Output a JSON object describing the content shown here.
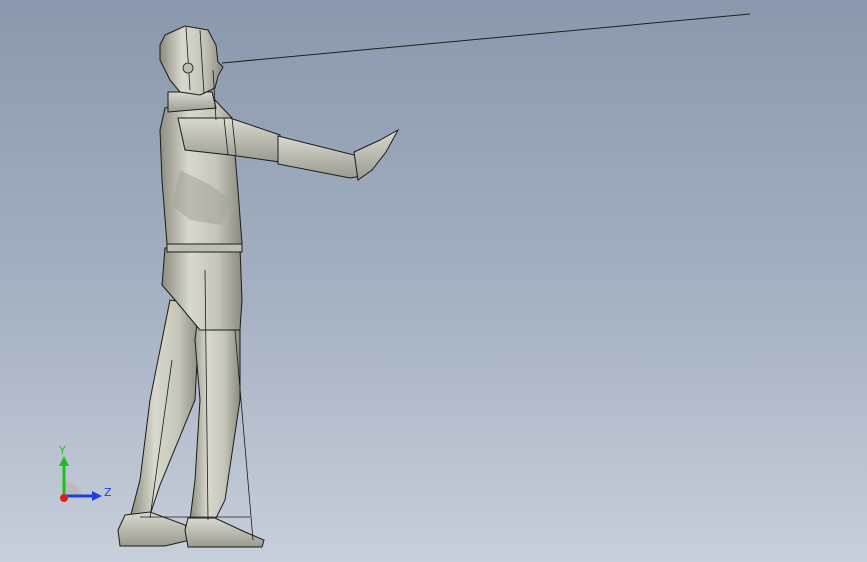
{
  "viewport": {
    "background_top": "#8a98ad",
    "background_bottom": "#c7cfda"
  },
  "model": {
    "type": "human-figure",
    "pose": "standing-arm-extended",
    "surface_color": "#c9c9bd",
    "shade_color": "#8f8f84",
    "edge_color": "#1b1b1b"
  },
  "sight_line": {
    "color": "#1e1e1e"
  },
  "triad": {
    "y_label": "Y",
    "z_label": "Z",
    "y_color": "#1fbf1f",
    "z_color": "#1f3fdf",
    "x_color": "#e02020",
    "plane_color": "#b8b8b8"
  }
}
